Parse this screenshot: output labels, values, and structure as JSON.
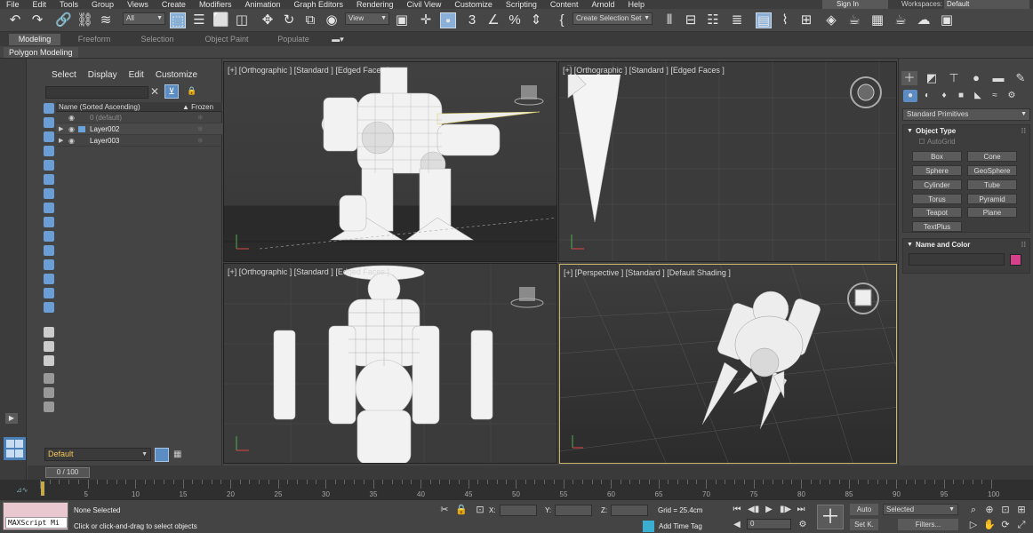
{
  "menu": [
    "File",
    "Edit",
    "Tools",
    "Group",
    "Views",
    "Create",
    "Modifiers",
    "Animation",
    "Graph Editors",
    "Rendering",
    "Civil View",
    "Customize",
    "Scripting",
    "Content",
    "Arnold",
    "Help"
  ],
  "account": {
    "signin": "Sign In",
    "workspaces_label": "Workspaces:",
    "workspace": "Default"
  },
  "toolbar": {
    "selection_filter": "All",
    "ref_coord": "View",
    "named_selection": "Create Selection Set",
    "accent": "#8ab0d8"
  },
  "ribbon": {
    "tabs": [
      "Modeling",
      "Freeform",
      "Selection",
      "Object Paint",
      "Populate"
    ],
    "active_tab": "Modeling",
    "panel": "Polygon Modeling"
  },
  "explorer": {
    "menu": [
      "Select",
      "Display",
      "Edit",
      "Customize"
    ],
    "col_name": "Name (Sorted Ascending)",
    "col_frozen": "▲ Frozen",
    "rows": [
      {
        "name": "0 (default)"
      },
      {
        "name": "Layer002"
      },
      {
        "name": "Layer003"
      }
    ],
    "layer": "Default"
  },
  "viewports": {
    "top": "[+] [Orthographic ] [Standard ] [Edged Faces ]",
    "front": "[+] [Orthographic ] [Standard ] [Edged Faces ]",
    "left": "[+] [Orthographic ] [Standard ] [Edged Faces ]",
    "perspective": "[+] [Perspective ] [Standard ] [Default Shading ]",
    "active_border": "#c9b46a"
  },
  "command_panel": {
    "category": "Standard Primitives",
    "object_type_title": "Object Type",
    "autogrid": "AutoGrid",
    "primitives": [
      "Box",
      "Cone",
      "Sphere",
      "GeoSphere",
      "Cylinder",
      "Tube",
      "Torus",
      "Pyramid",
      "Teapot",
      "Plane",
      "TextPlus"
    ],
    "name_color_title": "Name and Color",
    "object_color": "#d5418b"
  },
  "timeline": {
    "slider": "0 / 100",
    "ticks": [
      "0",
      "5",
      "10",
      "15",
      "20",
      "25",
      "30",
      "35",
      "40",
      "45",
      "50",
      "55",
      "60",
      "65",
      "70",
      "75",
      "80",
      "85",
      "90",
      "95",
      "100"
    ]
  },
  "status": {
    "maxscript": "MAXScript Mi",
    "selection": "None Selected",
    "hint": "Click or click-and-drag to select objects",
    "x_label": "X:",
    "y_label": "Y:",
    "z_label": "Z:",
    "grid": "Grid = 25.4cm",
    "add_time_tag": "Add Time Tag",
    "frame": "0",
    "auto": "Auto",
    "set_key": "Set K.",
    "key_filter": "Selected",
    "filters": "Filters..."
  }
}
